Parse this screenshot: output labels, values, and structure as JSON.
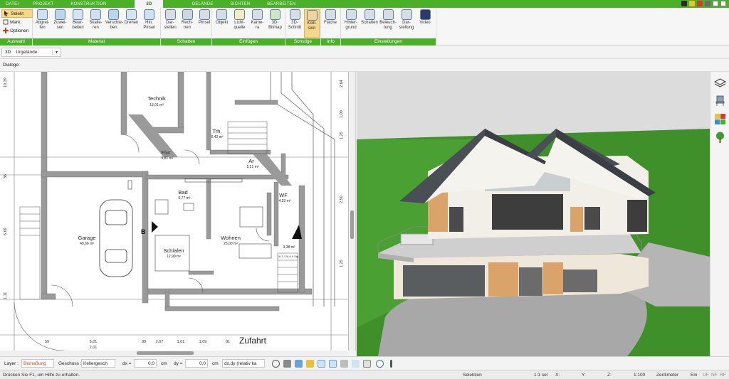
{
  "tabs": [
    "DATEI",
    "PROJEKT",
    "KONSTRUKTION",
    "3D",
    "GELÄNDE",
    "SICHTEN",
    "BEARBEITEN"
  ],
  "ribbon": {
    "auswahl": {
      "label": "Auswahl",
      "selekt": "Selekt",
      "mark": "Mark.",
      "optionen": "Optionen"
    },
    "material": {
      "label": "Material",
      "buttons": [
        "Abgrei-\nfen",
        "Zuwei-\nsen",
        "Bear-\nbeiten",
        "Skalie-\nren",
        "Verschie-\nben",
        "Drehen",
        "Hin.\nPinsel"
      ]
    },
    "schatten": {
      "label": "Schatten",
      "buttons": [
        "Dar-\nstellen",
        "Rech-\nnen",
        "Pinsel"
      ]
    },
    "einfuegen": {
      "label": "Einfügen",
      "buttons": [
        "Objekt",
        "Licht-\nquelle",
        "Kame-\nra",
        "3D-\nBitmap"
      ]
    },
    "sonstige": {
      "label": "Sonstige",
      "buttons": [
        "3D-\nSchnitt",
        "Kolli-\nsion"
      ]
    },
    "info": {
      "label": "Info",
      "buttons": [
        "Fläche"
      ]
    },
    "einstellungen": {
      "label": "Einstellungen",
      "buttons": [
        "Hinter-\ngrund",
        "Schatten",
        "Beleuch-\ntung",
        "Dar-\nstellung",
        "Video"
      ]
    }
  },
  "view_selector": {
    "prefix": "3D",
    "value": "Urgelände"
  },
  "dialoge_label": "Dialoge:",
  "plan": {
    "rooms": [
      {
        "name": "Technik",
        "area": "13,01 m²"
      },
      {
        "name": "Trh.",
        "area": "6,42 m²"
      },
      {
        "name": "Flur",
        "area": "9,81 m²"
      },
      {
        "name": "Ar",
        "area": "5,21 m²"
      },
      {
        "name": "Bad",
        "area": "6,77 m²"
      },
      {
        "name": "WF",
        "area": "4,33 m²"
      },
      {
        "name": "Garage",
        "area": "40,66 m²"
      },
      {
        "name": "Wohnen",
        "area": "25,00 m²"
      },
      {
        "name": "Schlafen",
        "area": "12,99 m²"
      },
      {
        "name": "",
        "area": "3,38 m²"
      }
    ],
    "street_label": "Zufahrt",
    "section_marker": "B",
    "left_dims": [
      "10,39",
      "36",
      "6,69",
      "1,11"
    ],
    "right_dims": [
      "2,64",
      "1,00",
      "1,25",
      "2,50",
      "1,25"
    ],
    "bottom_dims": [
      "59",
      "5,01",
      "2,01",
      "89",
      "2,07",
      "1,01",
      "1,09",
      "01"
    ],
    "stair_note": "16,3 / 26,6\n9 Stg."
  },
  "options_bar": {
    "layer_label": "Layer :",
    "layer_value": "Bemaßung",
    "geschoss_label": "Geschoss :",
    "geschoss_value": "Kellergesch",
    "dx_label": "dx =",
    "dx_value": "0,0",
    "dx_unit": "cm",
    "dy_label": "dy =",
    "dy_value": "0,0",
    "dy_unit": "cm",
    "mode_value": "dx,dy (relativ ka"
  },
  "status": {
    "help": "Drücken Sie F1, um Hilfe zu erhalten.",
    "mode": "Selektion",
    "scale_sel": "1:1 sel",
    "x_label": "X:",
    "y_label": "Y:",
    "z_label": "Z:",
    "zoom": "1:100",
    "unit": "Zentimeter",
    "ein": "Ein",
    "uf": "UF",
    "nf": "NF",
    "rf": "RF"
  },
  "colors": {
    "brand_green": "#4caf2a",
    "grass": "#3f8f2b",
    "roof": "#4a4f55",
    "wall": "#f1efe8",
    "wood_accent": "#d9a36a"
  }
}
